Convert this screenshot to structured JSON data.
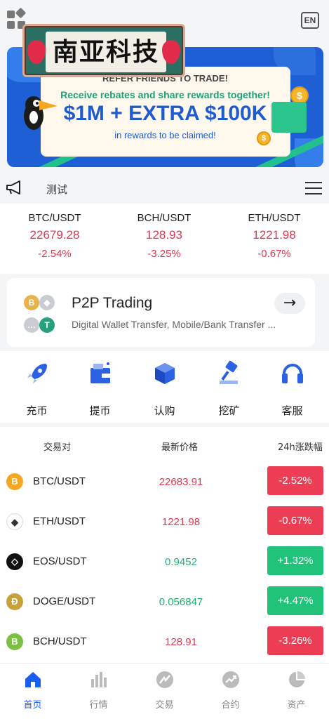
{
  "header": {
    "menu_icon": "grid-apps-icon",
    "lang_label": "EN",
    "logo_text": "南亚科技"
  },
  "banner": {
    "headline": "REFER FRIENDS TO TRADE!",
    "subline": "Receive rebates and share rewards together!",
    "big_text": "$1M + EXTRA $100K",
    "footer": "in rewards to be claimed!",
    "coin_symbol": "$"
  },
  "notice": {
    "icon": "megaphone-icon",
    "text": "测试",
    "list_icon": "list-icon"
  },
  "tickers": [
    {
      "pair": "BTC/USDT",
      "price": "22679.28",
      "change": "-2.54%"
    },
    {
      "pair": "BCH/USDT",
      "price": "128.93",
      "change": "-3.25%"
    },
    {
      "pair": "ETH/USDT",
      "price": "1221.98",
      "change": "-0.67%"
    }
  ],
  "p2p": {
    "title": "P2P Trading",
    "description": "Digital Wallet Transfer, Mobile/Bank Transfer ...",
    "arrow": "→"
  },
  "quick_actions": [
    {
      "label": "充币",
      "icon": "rocket-icon"
    },
    {
      "label": "提币",
      "icon": "wallet-icon"
    },
    {
      "label": "认购",
      "icon": "cube-icon"
    },
    {
      "label": "挖矿",
      "icon": "hammer-icon"
    },
    {
      "label": "客服",
      "icon": "headset-icon"
    }
  ],
  "market": {
    "headers": {
      "pair": "交易对",
      "price": "最新价格",
      "change": "24h涨跌幅"
    },
    "rows": [
      {
        "coin": "B",
        "pair": "BTC/USDT",
        "price": "22683.91",
        "change": "-2.52%",
        "dir": "down",
        "color": "#f5a623"
      },
      {
        "coin": "◆",
        "pair": "ETH/USDT",
        "price": "1221.98",
        "change": "-0.67%",
        "dir": "down",
        "color": "#ffffff"
      },
      {
        "coin": "◇",
        "pair": "EOS/USDT",
        "price": "0.9452",
        "change": "+1.32%",
        "dir": "up",
        "color": "#111111"
      },
      {
        "coin": "Đ",
        "pair": "DOGE/USDT",
        "price": "0.056847",
        "change": "+4.47%",
        "dir": "up",
        "color": "#c8a13a"
      },
      {
        "coin": "B",
        "pair": "BCH/USDT",
        "price": "128.91",
        "change": "-3.26%",
        "dir": "down",
        "color": "#7bc043"
      }
    ]
  },
  "tabbar": [
    {
      "label": "首页",
      "icon": "home-icon",
      "active": true
    },
    {
      "label": "行情",
      "icon": "bar-chart-icon",
      "active": false
    },
    {
      "label": "交易",
      "icon": "trade-icon",
      "active": false
    },
    {
      "label": "合约",
      "icon": "trend-icon",
      "active": false
    },
    {
      "label": "资产",
      "icon": "pie-chart-icon",
      "active": false
    }
  ],
  "colors": {
    "accent": "#1a5ef0",
    "down": "#ec3d55",
    "up": "#21c27a"
  }
}
